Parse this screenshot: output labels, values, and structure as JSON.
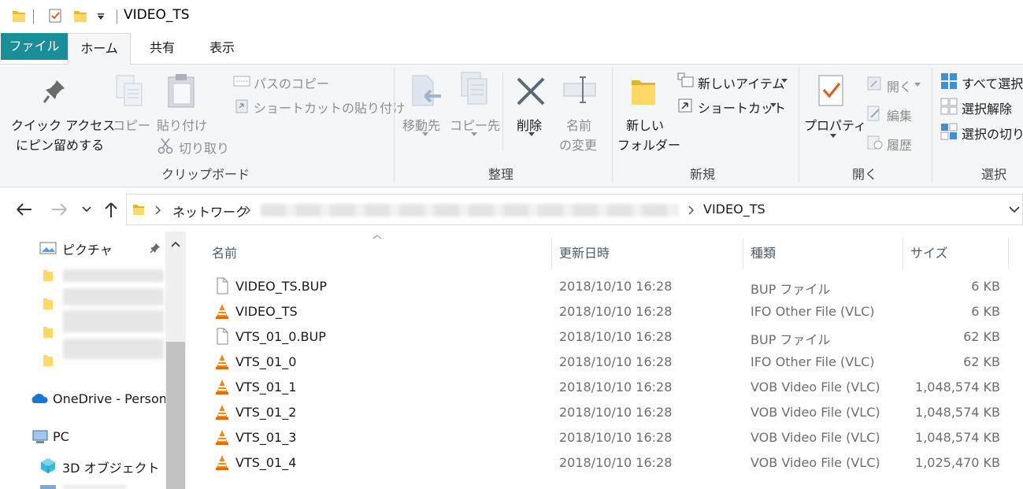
{
  "window": {
    "title": "VIDEO_TS"
  },
  "tabs": [
    {
      "label": "ファイル"
    },
    {
      "label": "ホーム"
    },
    {
      "label": "共有"
    },
    {
      "label": "表示"
    }
  ],
  "ribbon": {
    "clipboard": {
      "pin_line1": "クイック アクセス",
      "pin_line2": "にピン留めする",
      "copy": "コピー",
      "paste": "貼り付け",
      "copy_path": "パスのコピー",
      "paste_shortcut": "ショートカットの貼り付け",
      "cut": "切り取り",
      "label": "クリップボード"
    },
    "organize": {
      "move_to": "移動先",
      "copy_to": "コピー先",
      "delete": "削除",
      "rename_line1": "名前",
      "rename_line2": "の変更",
      "label": "整理"
    },
    "new": {
      "folder_line1": "新しい",
      "folder_line2": "フォルダー",
      "new_item": "新しいアイテム",
      "shortcut": "ショートカット",
      "label": "新規"
    },
    "open": {
      "properties": "プロパティ",
      "open": "開く",
      "edit": "編集",
      "history": "履歴",
      "label": "開く"
    },
    "select": {
      "select_all": "すべて選択",
      "select_none": "選択解除",
      "invert": "選択の切り",
      "label": "選択"
    }
  },
  "address": {
    "crumbs": [
      "ネットワーク",
      "VIDEO_TS"
    ]
  },
  "nav": {
    "pictures": "ピクチャ",
    "onedrive": "OneDrive - Person",
    "pc": "PC",
    "objects3d": "3D オブジェクト"
  },
  "columns": {
    "name": "名前",
    "date": "更新日時",
    "type": "種類",
    "size": "サイズ"
  },
  "files": [
    {
      "name": "VIDEO_TS.BUP",
      "date": "2018/10/10 16:28",
      "type": "BUP ファイル",
      "size": "6 KB",
      "icon": "blank-file-icon"
    },
    {
      "name": "VIDEO_TS",
      "date": "2018/10/10 16:28",
      "type": "IFO Other File (VLC)",
      "size": "6 KB",
      "icon": "vlc-icon"
    },
    {
      "name": "VTS_01_0.BUP",
      "date": "2018/10/10 16:28",
      "type": "BUP ファイル",
      "size": "62 KB",
      "icon": "blank-file-icon"
    },
    {
      "name": "VTS_01_0",
      "date": "2018/10/10 16:28",
      "type": "IFO Other File (VLC)",
      "size": "62 KB",
      "icon": "vlc-icon"
    },
    {
      "name": "VTS_01_1",
      "date": "2018/10/10 16:28",
      "type": "VOB Video File (VLC)",
      "size": "1,048,574 KB",
      "icon": "vlc-icon"
    },
    {
      "name": "VTS_01_2",
      "date": "2018/10/10 16:28",
      "type": "VOB Video File (VLC)",
      "size": "1,048,574 KB",
      "icon": "vlc-icon"
    },
    {
      "name": "VTS_01_3",
      "date": "2018/10/10 16:28",
      "type": "VOB Video File (VLC)",
      "size": "1,048,574 KB",
      "icon": "vlc-icon"
    },
    {
      "name": "VTS_01_4",
      "date": "2018/10/10 16:28",
      "type": "VOB Video File (VLC)",
      "size": "1,025,470 KB",
      "icon": "vlc-icon"
    }
  ]
}
